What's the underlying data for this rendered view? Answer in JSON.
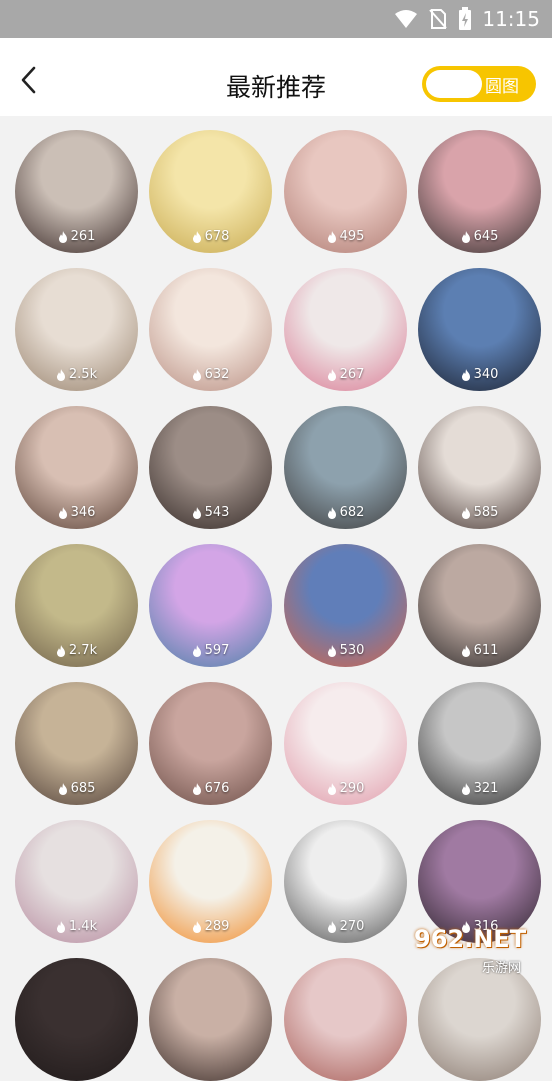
{
  "status": {
    "time": "11:15"
  },
  "header": {
    "title": "最新推荐",
    "toggle_label": "圆图"
  },
  "avatars": [
    {
      "count": "261",
      "c1": "#cbbfb6",
      "c2": "#3a2a28"
    },
    {
      "count": "678",
      "c1": "#f4e5a9",
      "c2": "#c7a94f"
    },
    {
      "count": "495",
      "c1": "#e8c7c0",
      "c2": "#b07d74"
    },
    {
      "count": "645",
      "c1": "#d9a3aa",
      "c2": "#35302f"
    },
    {
      "count": "2.5k",
      "c1": "#e7ddd3",
      "c2": "#9a8570"
    },
    {
      "count": "632",
      "c1": "#f3e6dd",
      "c2": "#b98f83"
    },
    {
      "count": "267",
      "c1": "#efe8e8",
      "c2": "#d97b94"
    },
    {
      "count": "340",
      "c1": "#5c7fb2",
      "c2": "#1c2230"
    },
    {
      "count": "346",
      "c1": "#d8bfb3",
      "c2": "#5c4338"
    },
    {
      "count": "543",
      "c1": "#9c8d86",
      "c2": "#342a27"
    },
    {
      "count": "682",
      "c1": "#8da1ad",
      "c2": "#3e3d3d"
    },
    {
      "count": "585",
      "c1": "#e4dcd6",
      "c2": "#4a3a36"
    },
    {
      "count": "2.7k",
      "c1": "#c3b98a",
      "c2": "#6f6049"
    },
    {
      "count": "597",
      "c1": "#d3a5e6",
      "c2": "#4b7fa6"
    },
    {
      "count": "530",
      "c1": "#607eb9",
      "c2": "#d4664a"
    },
    {
      "count": "611",
      "c1": "#bca9a1",
      "c2": "#2e2a2a"
    },
    {
      "count": "685",
      "c1": "#c6b397",
      "c2": "#53423a"
    },
    {
      "count": "676",
      "c1": "#c9a59e",
      "c2": "#6b4d46"
    },
    {
      "count": "290",
      "c1": "#f6eced",
      "c2": "#e09aa9"
    },
    {
      "count": "321",
      "c1": "#c6c6c6",
      "c2": "#333333"
    },
    {
      "count": "1.4k",
      "c1": "#e6e0e0",
      "c2": "#b78ca0"
    },
    {
      "count": "289",
      "c1": "#f4f1e8",
      "c2": "#f08b2a"
    },
    {
      "count": "270",
      "c1": "#eeeeee",
      "c2": "#555555"
    },
    {
      "count": "316",
      "c1": "#a07aa2",
      "c2": "#2b222a"
    },
    {
      "count": "",
      "c1": "#3a3030",
      "c2": "#201a1a"
    },
    {
      "count": "",
      "c1": "#c9b0a5",
      "c2": "#3a2c28"
    },
    {
      "count": "",
      "c1": "#e6c8c8",
      "c2": "#a9605a"
    },
    {
      "count": "",
      "c1": "#dcd6d0",
      "c2": "#8a7a70"
    }
  ],
  "watermark": {
    "top": "962.NET",
    "bottom": "乐游网"
  }
}
